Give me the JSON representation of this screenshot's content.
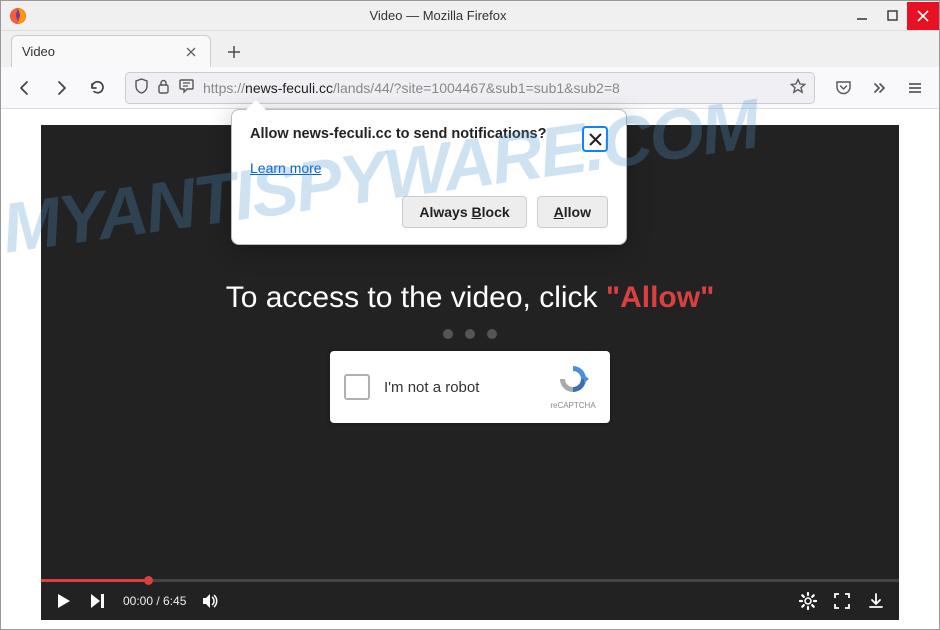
{
  "window": {
    "title": "Video — Mozilla Firefox"
  },
  "tab": {
    "label": "Video"
  },
  "url": {
    "prefix": "https://",
    "domain": "news-feculi.cc",
    "path": "/lands/44/?site=1004467&sub1=sub1&sub2=8"
  },
  "popup": {
    "title": "Allow news-feculi.cc to send notifications?",
    "learn_more": "Learn more",
    "block_prefix": "Always ",
    "block_u": "B",
    "block_suffix": "lock",
    "allow_u": "A",
    "allow_suffix": "llow"
  },
  "videoPage": {
    "instruction_prefix": "To access to the video, click ",
    "instruction_allow": "\"Allow\"",
    "captcha_label": "I'm not a robot",
    "recaptcha_label": "reCAPTCHA"
  },
  "player": {
    "time": "00:00 / 6:45"
  },
  "watermark": "MYANTISPYWARE.COM"
}
